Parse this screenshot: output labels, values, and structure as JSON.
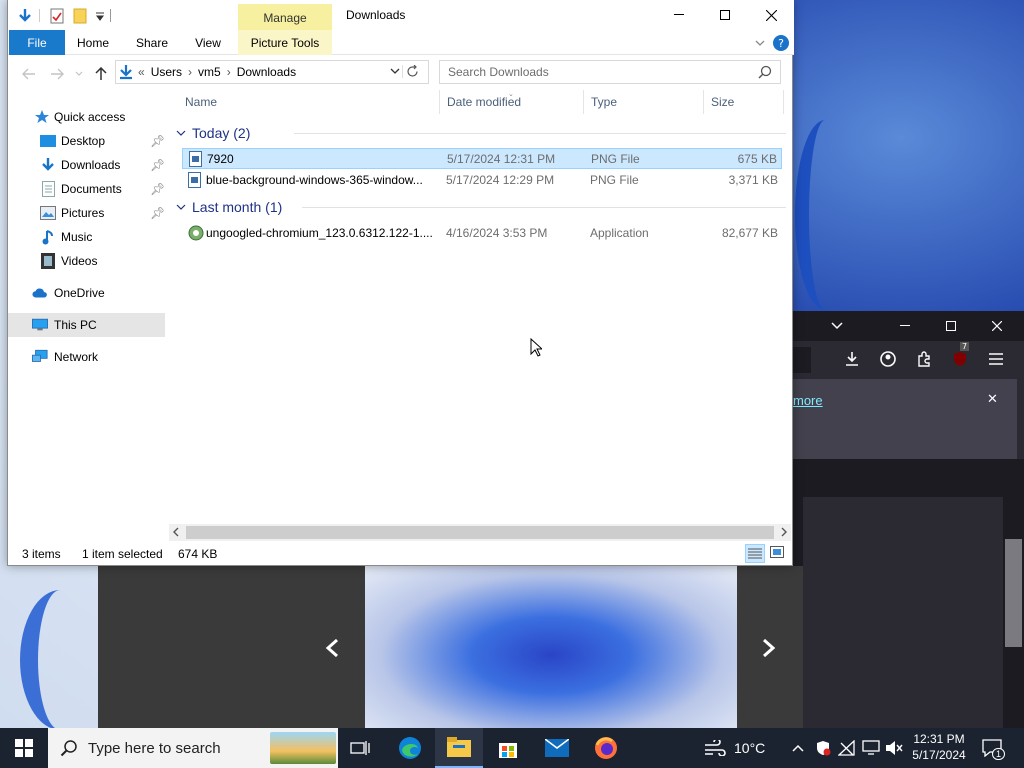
{
  "explorer": {
    "title": "Downloads",
    "manage_label": "Manage",
    "ribbon_tabs": [
      "File",
      "Home",
      "Share",
      "View",
      "Picture Tools"
    ],
    "address": {
      "crumb_prefix": "«",
      "crumbs": [
        "Users",
        "vm5",
        "Downloads"
      ]
    },
    "search_placeholder": "Search Downloads",
    "nav": {
      "quick_access": "Quick access",
      "items": [
        "Desktop",
        "Downloads",
        "Documents",
        "Pictures",
        "Music",
        "Videos"
      ],
      "onedrive": "OneDrive",
      "this_pc": "This PC",
      "network": "Network"
    },
    "columns": [
      "Name",
      "Date modified",
      "Type",
      "Size"
    ],
    "groups": [
      {
        "label": "Today (2)",
        "files": [
          {
            "name": "7920",
            "date": "5/17/2024 12:31 PM",
            "type": "PNG File",
            "size": "675 KB",
            "selected": true
          },
          {
            "name": "blue-background-windows-365-window...",
            "date": "5/17/2024 12:29 PM",
            "type": "PNG File",
            "size": "3,371 KB",
            "selected": false
          }
        ]
      },
      {
        "label": "Last month (1)",
        "files": [
          {
            "name": "ungoogled-chromium_123.0.6312.122-1....",
            "date": "4/16/2024 3:53 PM",
            "type": "Application",
            "size": "82,677 KB",
            "selected": false
          }
        ]
      }
    ],
    "status": {
      "count": "3 items",
      "selection": "1 item selected",
      "size": "674 KB"
    }
  },
  "browser": {
    "notice_link": "more",
    "extension_badge": "7"
  },
  "taskbar": {
    "search_placeholder": "Type here to search",
    "weather": "10°C",
    "time": "12:31 PM",
    "date": "5/17/2024",
    "notification_count": "1"
  },
  "colors": {
    "file_tab": "#1979ca",
    "manage_tab": "#f7f0a0",
    "selection": "#cce8ff",
    "group_header": "#1e3287",
    "taskbar": "#1b2230"
  }
}
